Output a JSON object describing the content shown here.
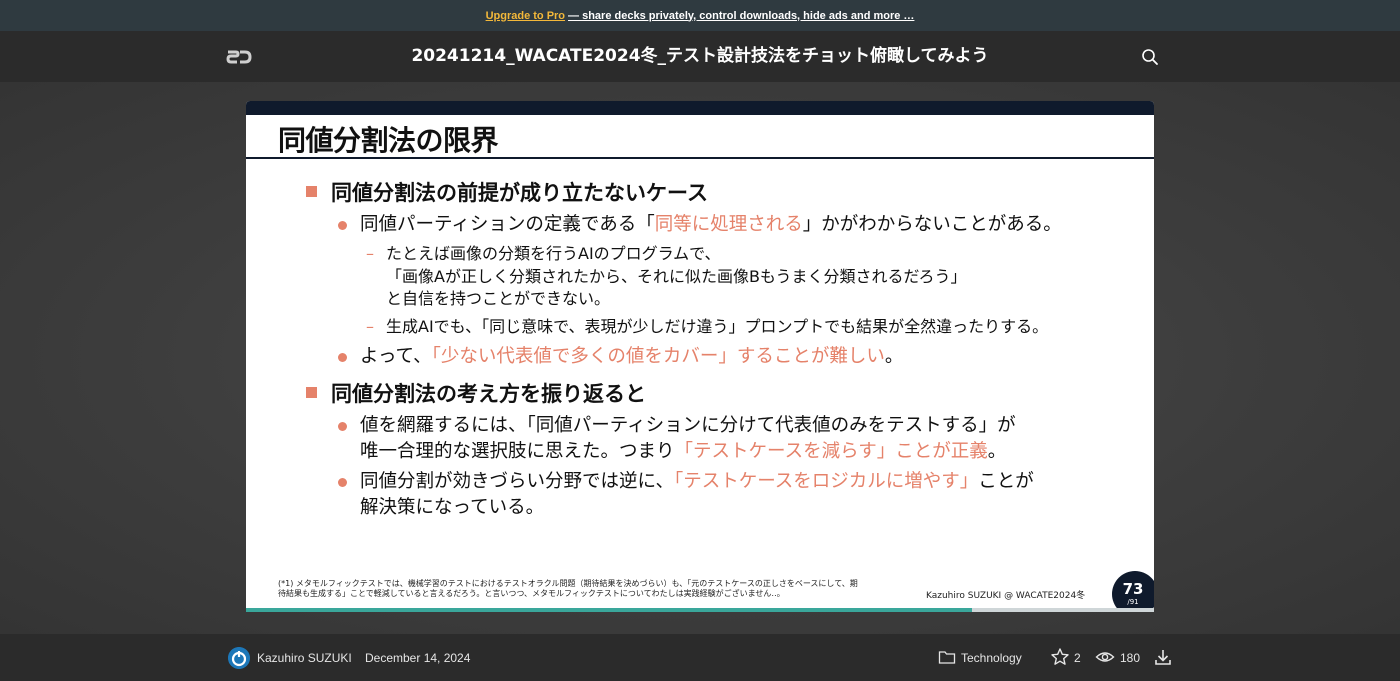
{
  "promo": {
    "link_label": "Upgrade to Pro",
    "text": "— share decks privately, control downloads, hide ads and more …"
  },
  "header": {
    "logo_text": "SD",
    "title": "20241214_WACATE2024冬_テスト設計技法をチョット俯瞰してみよう",
    "search_icon": "search-icon"
  },
  "slide": {
    "heading": "同値分割法の限界",
    "sections": [
      {
        "title": "同値分割法の前提が成り立たないケース",
        "bullets": [
          {
            "before": "同値パーティションの定義である「",
            "highlight": "同等に処理される",
            "after": "」かがわからないことがある。"
          }
        ],
        "subitems": [
          {
            "lines": [
              "たとえば画像の分類を行うAIのプログラムで、",
              "「画像Aが正しく分類されたから、それに似た画像Bもうまく分類されるだろう」",
              "と自信を持つことができない。"
            ]
          },
          {
            "lines": [
              "生成AIでも、「同じ意味で、表現が少しだけ違う」プロンプトでも結果が全然違ったりする。"
            ]
          }
        ],
        "bullet2": {
          "before": "よって、",
          "highlight": "「少ない代表値で多くの値をカバー」することが難しい",
          "after": "。"
        }
      },
      {
        "title": "同値分割法の考え方を振り返ると",
        "bullet1": {
          "line1": "値を網羅するには、「同値パーティションに分けて代表値のみをテストする」が",
          "line2_before": "唯一合理的な選択肢に思えた。つまり",
          "line2_highlight": "「テストケースを減らす」ことが正義",
          "line2_after": "。"
        },
        "bullet2": {
          "line1_before": "同値分割が効きづらい分野では逆に、",
          "line1_highlight": "「テストケースをロジカルに増やす」",
          "line1_after": "ことが",
          "line2": "解決策になっている。"
        }
      }
    ],
    "footnote_lines": [
      "(*1) メタモルフィックテストでは、機械学習のテストにおけるテストオラクル問題（期待結果を決めづらい）も、「元のテストケースの正しさをベースにして、期",
      "待結果も生成する」ことで軽減していると言えるだろう。と言いつつ、メタモルフィックテストについてわたしは実践経験がございません‥。"
    ],
    "author_tag": "Kazuhiro SUZUKI @ WACATE2024冬",
    "page_number": "73",
    "page_total": "/91",
    "progress": 0.8
  },
  "footer": {
    "author": "Kazuhiro SUZUKI",
    "date": "December 14, 2024",
    "category": "Technology",
    "stars": "2",
    "views": "180"
  },
  "colors": {
    "accent": "#e5826a",
    "progress": "#3aa79b",
    "promo_link": "#f3b83a",
    "slide_navy": "#0f1a2c"
  }
}
